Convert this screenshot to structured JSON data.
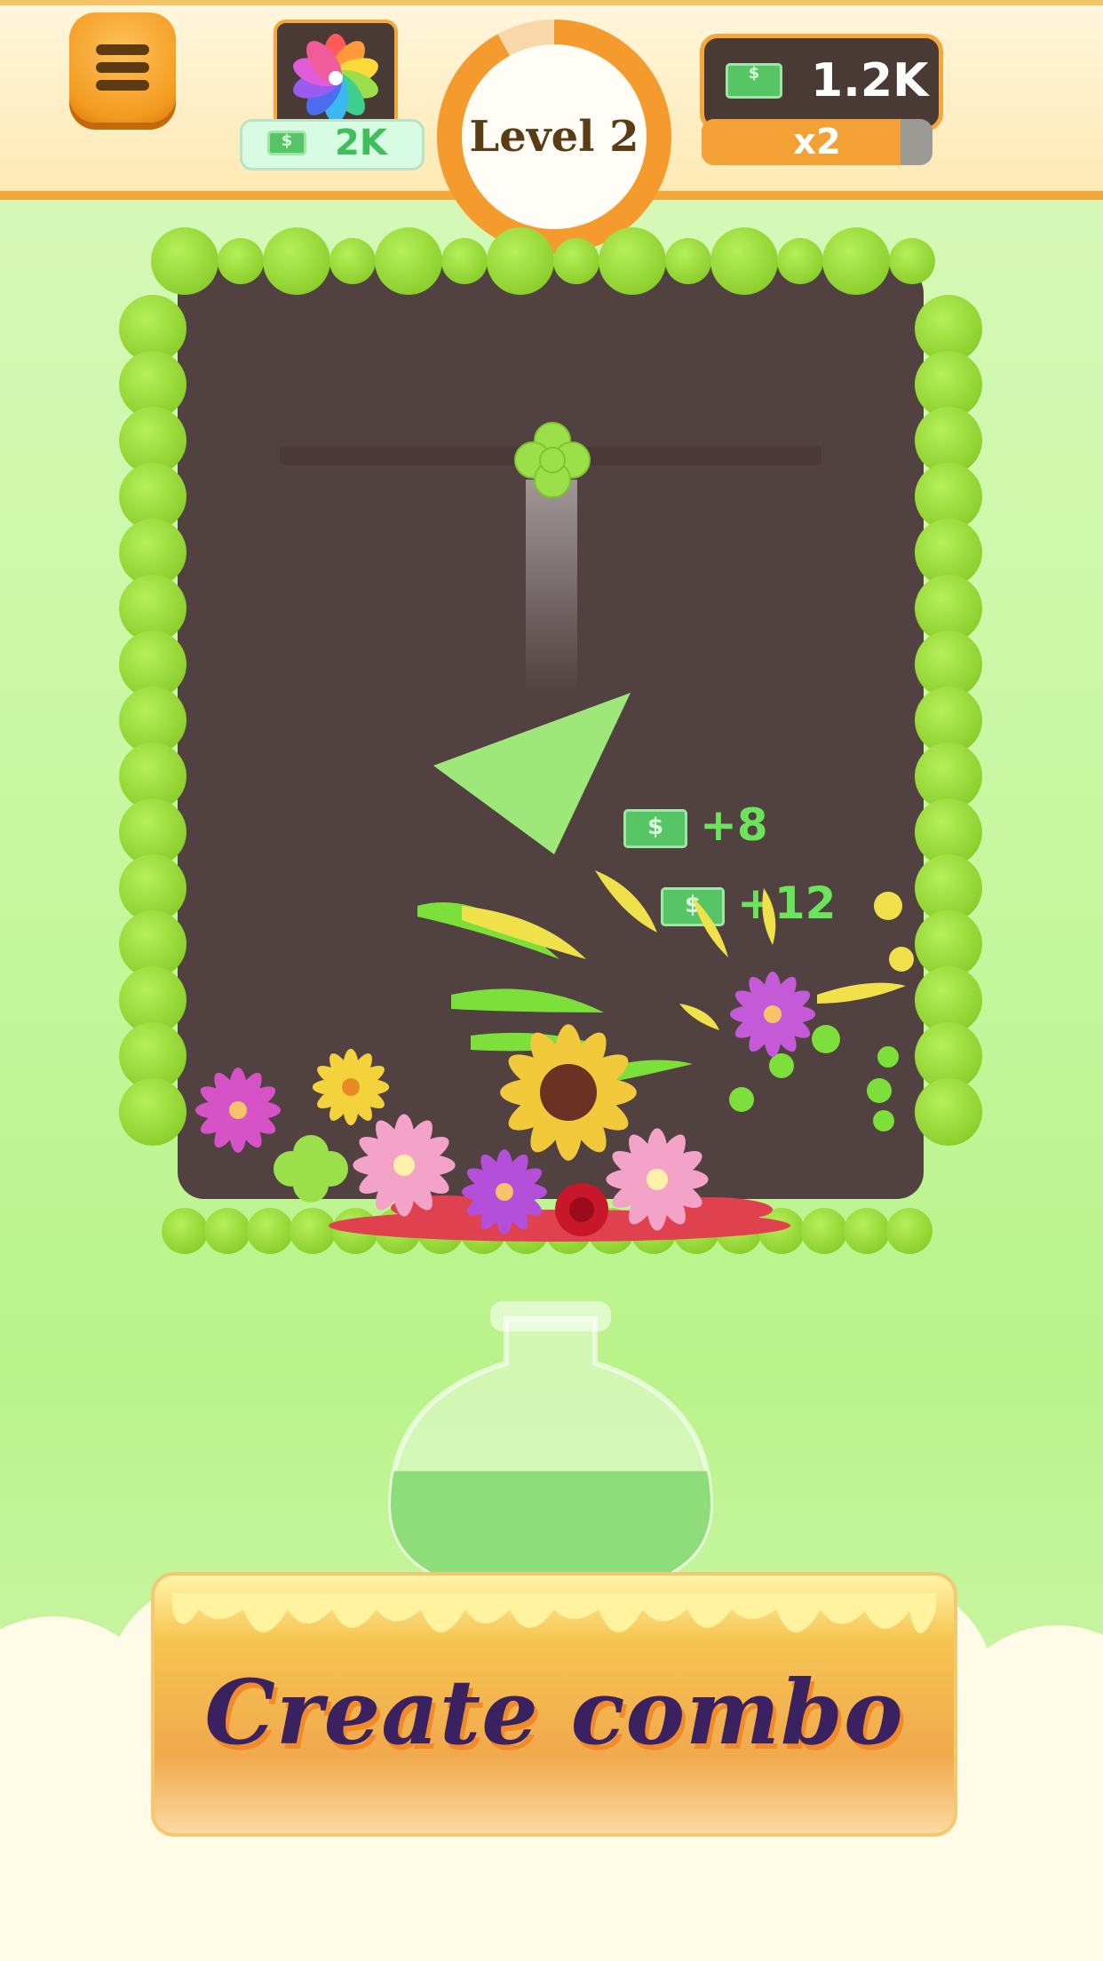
{
  "header": {
    "menu_icon": "hamburger-menu-icon",
    "collection": {
      "icon": "rainbow-flower-icon",
      "price": "2K",
      "price_icon": "cash-icon"
    },
    "level": {
      "label": "Level 2",
      "progress_fraction": 0.92
    },
    "money": {
      "amount": "1.2K",
      "icon": "cash-icon"
    },
    "multiplier": {
      "label": "x2",
      "progress_fraction": 0.86
    }
  },
  "board": {
    "dropper_icon": "clover-dropper-icon",
    "obstacle_icon": "green-triangle-obstacle",
    "gains": [
      "+8",
      "+12"
    ],
    "flowers": [
      "pink-daisy",
      "yellow-lily",
      "green-clover",
      "pink-lotus",
      "purple-daisy",
      "red-rose",
      "sunflower",
      "pink-lotus",
      "purple-daisy"
    ]
  },
  "bottle": {
    "icon": "potion-bottle-icon",
    "fill_fraction": 0.42,
    "liquid_color": "#8fdc7a"
  },
  "banner": {
    "text": "Create combo"
  },
  "colors": {
    "accent": "#f59b2e",
    "board": "#524141",
    "dot_green": "#8ed12f",
    "banner_text": "#3a2160"
  }
}
